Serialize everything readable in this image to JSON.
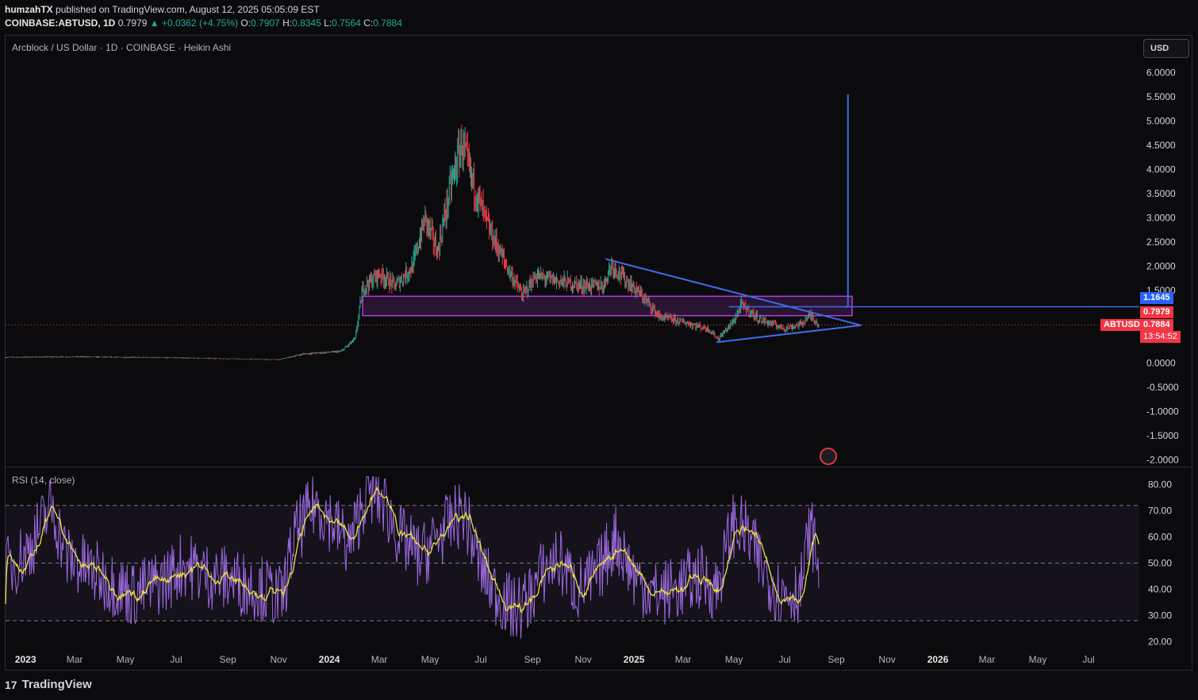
{
  "header": {
    "publisher": "humzahTX",
    "published_text": "published on TradingView.com, August 12, 2025 05:05:09 EST",
    "symbol": "COINBASE:ABTUSD, 1D",
    "last": "0.7979",
    "change": "▲ +0.0362 (+4.75%)",
    "o_label": "O:",
    "o": "0.7907",
    "h_label": "H:",
    "h": "0.8345",
    "l_label": "L:",
    "l": "0.7564",
    "c_label": "C:",
    "c": "0.7884"
  },
  "currency_button": "USD",
  "price_tags": {
    "level": "1.1645",
    "last": "0.7979",
    "symbol": "ABTUSD",
    "close": "0.7884",
    "countdown": "13:54:52"
  },
  "footer": {
    "brand": "TradingView",
    "logo": "17"
  },
  "colors": {
    "up": "#22ab94",
    "down": "#f23645",
    "drawing": "#3d6be8",
    "zone": "#b03ee0",
    "rsi": "#9c6ae0",
    "rsi_ma": "#e8e43c",
    "tag_red": "#f23645",
    "tag_blue": "#2962ff"
  },
  "chart_data": [
    {
      "type": "candlestick",
      "title": "Arcblock / US Dollar · 1D · COINBASE · Heikin Ashi",
      "x_ticks": [
        "2023",
        "Mar",
        "May",
        "Jul",
        "Sep",
        "Nov",
        "2024",
        "Mar",
        "May",
        "Jul",
        "Sep",
        "Nov",
        "2025",
        "Mar",
        "May",
        "Jul",
        "Sep",
        "Nov",
        "2026",
        "Mar",
        "May",
        "Jul"
      ],
      "y_ticks": [
        "6.0000",
        "5.5000",
        "5.0000",
        "4.5000",
        "4.0000",
        "3.5000",
        "3.0000",
        "2.5000",
        "2.0000",
        "1.5000",
        "0.0000",
        "-0.5000",
        "-1.0000",
        "-1.5000",
        "-2.0000"
      ],
      "ylim": [
        -2.0,
        6.0
      ],
      "xlim": [
        "2022-12-08",
        "2026-08-31"
      ],
      "price_path": [
        [
          "2022-12-08",
          0.12
        ],
        [
          "2023-03-01",
          0.13
        ],
        [
          "2023-07-01",
          0.11
        ],
        [
          "2023-11-01",
          0.07
        ],
        [
          "2023-12-01",
          0.19
        ],
        [
          "2024-01-15",
          0.24
        ],
        [
          "2024-02-01",
          0.5
        ],
        [
          "2024-02-10",
          1.55
        ],
        [
          "2024-03-01",
          1.85
        ],
        [
          "2024-03-20",
          1.6
        ],
        [
          "2024-04-10",
          2.0
        ],
        [
          "2024-04-25",
          3.0
        ],
        [
          "2024-05-10",
          2.3
        ],
        [
          "2024-05-25",
          3.6
        ],
        [
          "2024-06-08",
          4.55
        ],
        [
          "2024-06-20",
          3.8
        ],
        [
          "2024-07-10",
          2.8
        ],
        [
          "2024-08-01",
          2.0
        ],
        [
          "2024-08-20",
          1.4
        ],
        [
          "2024-09-05",
          1.8
        ],
        [
          "2024-10-01",
          1.7
        ],
        [
          "2024-11-01",
          1.6
        ],
        [
          "2024-11-25",
          1.6
        ],
        [
          "2024-12-05",
          2.05
        ],
        [
          "2024-12-20",
          1.75
        ],
        [
          "2025-01-10",
          1.4
        ],
        [
          "2025-02-01",
          0.95
        ],
        [
          "2025-03-01",
          0.85
        ],
        [
          "2025-04-01",
          0.7
        ],
        [
          "2025-04-12",
          0.5
        ],
        [
          "2025-04-30",
          0.85
        ],
        [
          "2025-05-10",
          1.2
        ],
        [
          "2025-06-01",
          0.9
        ],
        [
          "2025-07-01",
          0.72
        ],
        [
          "2025-07-20",
          0.8
        ],
        [
          "2025-08-01",
          1.0
        ],
        [
          "2025-08-11",
          0.79
        ]
      ],
      "drawings": {
        "zone": {
          "from": "2024-02-10",
          "to": "2025-09-20",
          "low": 0.98,
          "high": 1.38
        },
        "level": 1.1645,
        "target_line_x": "2025-09-15",
        "target_top": 5.55
      },
      "last_price": 0.7884
    },
    {
      "type": "line",
      "title": "RSI (14, close)",
      "y_ticks": [
        "80.00",
        "70.00",
        "60.00",
        "50.00",
        "40.00",
        "30.00",
        "20.00"
      ],
      "ylim": [
        16.5,
        83.5
      ],
      "bands": [
        72,
        50,
        28
      ],
      "rsi_path": [
        [
          "2022-12-08",
          47
        ],
        [
          "2023-01-05",
          55
        ],
        [
          "2023-02-01",
          72
        ],
        [
          "2023-02-20",
          52
        ],
        [
          "2023-04-01",
          45
        ],
        [
          "2023-05-10",
          38
        ],
        [
          "2023-06-20",
          44
        ],
        [
          "2023-07-10",
          50
        ],
        [
          "2023-08-10",
          45
        ],
        [
          "2023-09-01",
          44
        ],
        [
          "2023-10-15",
          40
        ],
        [
          "2023-11-05",
          36
        ],
        [
          "2023-11-20",
          60
        ],
        [
          "2023-12-15",
          73
        ],
        [
          "2024-01-05",
          66
        ],
        [
          "2024-01-25",
          56
        ],
        [
          "2024-02-15",
          78
        ],
        [
          "2024-03-05",
          74
        ],
        [
          "2024-03-25",
          60
        ],
        [
          "2024-04-20",
          52
        ],
        [
          "2024-05-10",
          60
        ],
        [
          "2024-06-10",
          70
        ],
        [
          "2024-07-01",
          48
        ],
        [
          "2024-07-20",
          38
        ],
        [
          "2024-08-10",
          32
        ],
        [
          "2024-08-25",
          35
        ],
        [
          "2024-09-10",
          45
        ],
        [
          "2024-10-01",
          52
        ],
        [
          "2024-10-25",
          40
        ],
        [
          "2024-11-15",
          44
        ],
        [
          "2024-12-10",
          60
        ],
        [
          "2025-01-01",
          45
        ],
        [
          "2025-01-25",
          38
        ],
        [
          "2025-02-20",
          40
        ],
        [
          "2025-03-20",
          45
        ],
        [
          "2025-04-10",
          40
        ],
        [
          "2025-04-30",
          65
        ],
        [
          "2025-05-15",
          62
        ],
        [
          "2025-06-05",
          48
        ],
        [
          "2025-06-25",
          38
        ],
        [
          "2025-07-20",
          40
        ],
        [
          "2025-08-01",
          64
        ],
        [
          "2025-08-11",
          48
        ]
      ]
    }
  ]
}
